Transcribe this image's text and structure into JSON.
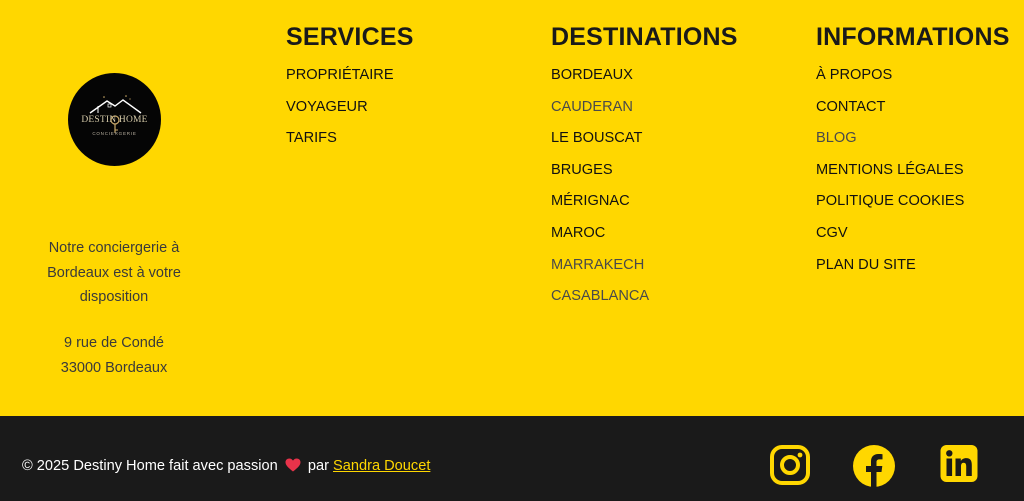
{
  "brand": {
    "logo_title": "DESTIN HOME",
    "logo_subtitle": "CONCIERGERIE",
    "description": "Notre conciergerie à Bordeaux est à votre disposition",
    "address_line1": "9 rue de Condé",
    "address_line2": "33000 Bordeaux"
  },
  "columns": {
    "services": {
      "title": "SERVICES",
      "items": [
        "PROPRIÉTAIRE",
        "VOYAGEUR",
        "TARIFS"
      ]
    },
    "destinations": {
      "title": "DESTINATIONS",
      "items": [
        "BORDEAUX",
        "CAUDERAN",
        "LE BOUSCAT",
        "BRUGES",
        "MÉRIGNAC",
        "MAROC",
        "MARRAKECH",
        "CASABLANCA"
      ]
    },
    "informations": {
      "title": "INFORMATIONS",
      "items": [
        "À PROPOS",
        "CONTACT",
        "BLOG",
        "MENTIONS LÉGALES",
        "POLITIQUE COOKIES",
        "CGV",
        "PLAN DU SITE"
      ]
    }
  },
  "footer": {
    "copyright_text": "© 2025 Destiny Home fait avec passion",
    "by_text": "par",
    "author_link": "Sandra Doucet"
  },
  "social": {
    "icons": [
      "instagram-icon",
      "facebook-icon",
      "linkedin-icon"
    ]
  },
  "colors": {
    "brand_yellow": "#FFD700",
    "dark_bar": "#1a1a1a",
    "heart": "#e8334a"
  }
}
